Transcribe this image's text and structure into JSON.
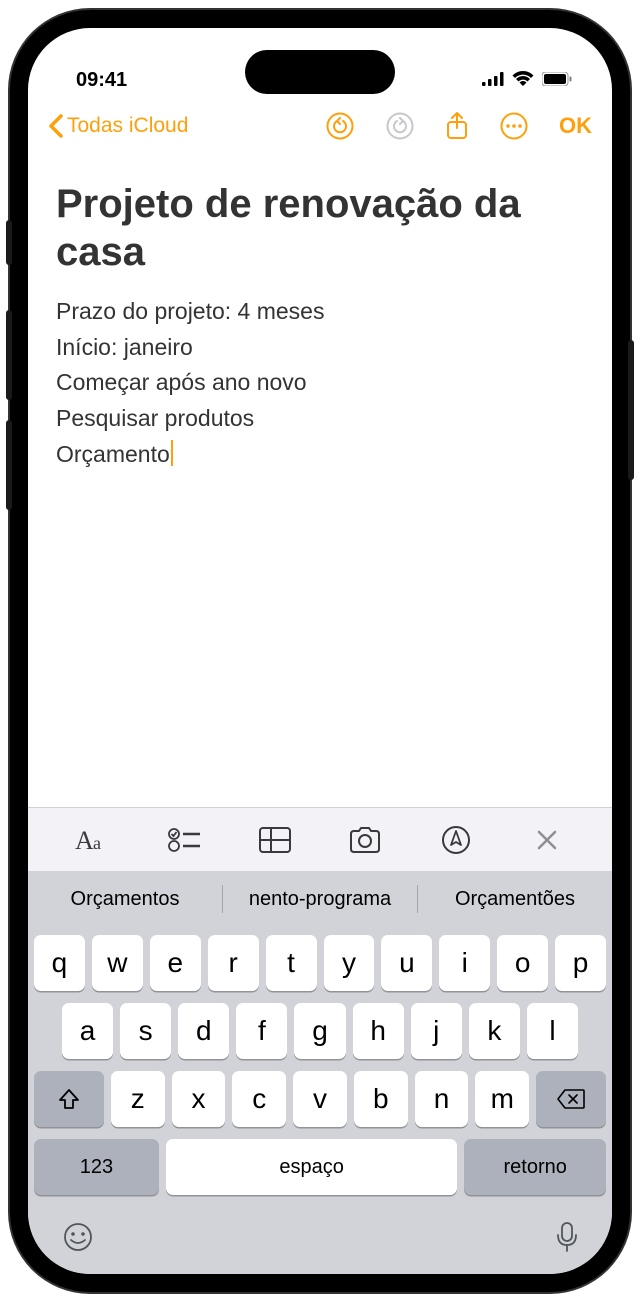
{
  "status": {
    "time": "09:41"
  },
  "nav": {
    "back_label": "Todas iCloud",
    "ok_label": "OK"
  },
  "note": {
    "title": "Projeto de renovação da casa",
    "lines": [
      "Prazo do projeto: 4 meses",
      "Início: janeiro",
      "Começar após ano novo",
      "Pesquisar produtos",
      "Orçamento"
    ]
  },
  "suggestions": [
    "Orçamentos",
    "nento-programa",
    "Orçamentões"
  ],
  "keyboard": {
    "row1": [
      "q",
      "w",
      "e",
      "r",
      "t",
      "y",
      "u",
      "i",
      "o",
      "p"
    ],
    "row2": [
      "a",
      "s",
      "d",
      "f",
      "g",
      "h",
      "j",
      "k",
      "l"
    ],
    "row3": [
      "z",
      "x",
      "c",
      "v",
      "b",
      "n",
      "m"
    ],
    "num_label": "123",
    "space_label": "espaço",
    "return_label": "retorno"
  }
}
